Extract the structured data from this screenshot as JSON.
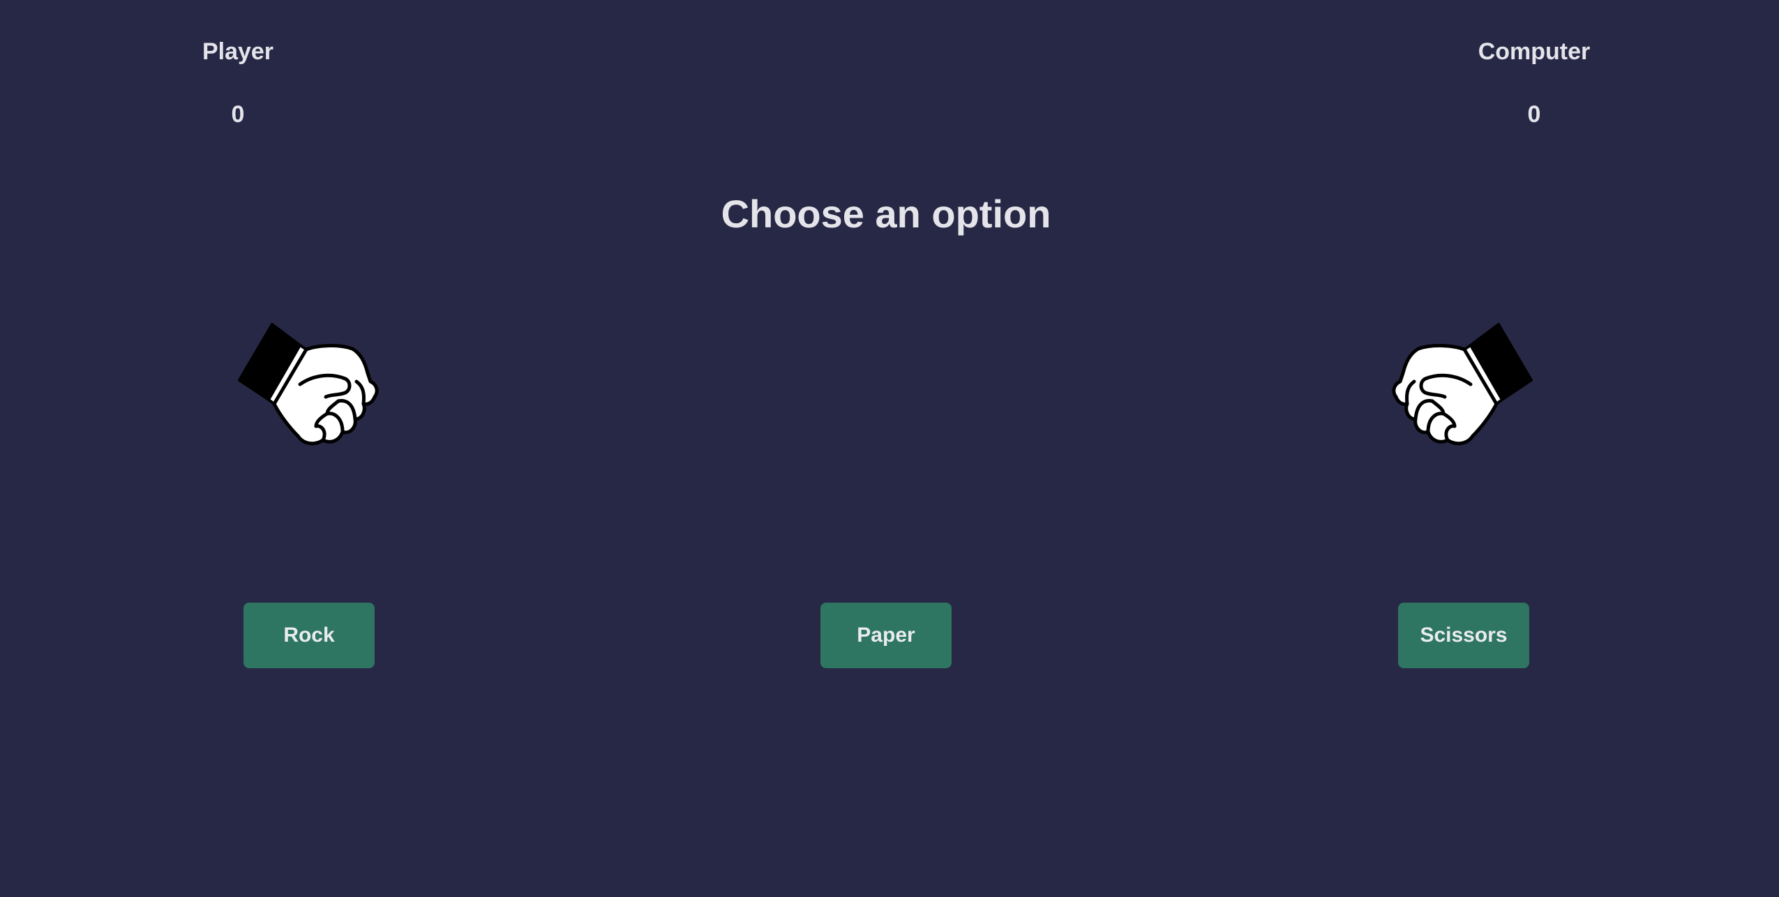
{
  "scoreboard": {
    "player": {
      "label": "Player",
      "score": "0"
    },
    "computer": {
      "label": "Computer",
      "score": "0"
    }
  },
  "prompt": "Choose an option",
  "hands": {
    "player": {
      "icon": "fist-icon"
    },
    "computer": {
      "icon": "fist-icon"
    }
  },
  "choices": [
    {
      "label": "Rock"
    },
    {
      "label": "Paper"
    },
    {
      "label": "Scissors"
    }
  ],
  "colors": {
    "background": "#272845",
    "text": "#e4e4ea",
    "button": "#2e7562"
  }
}
